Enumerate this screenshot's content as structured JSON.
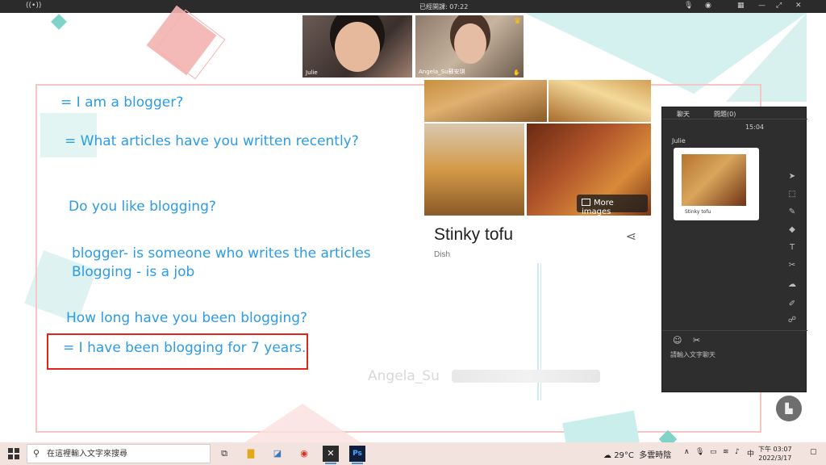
{
  "meeting": {
    "status_text": "已經開課: 07:22",
    "participant1_label": "Julie",
    "participant2_label": "Angela_Su蘇安琪"
  },
  "whiteboard": {
    "lines": [
      "= I am a blogger?",
      "= What articles have you written recently?",
      "Do you like blogging?",
      "blogger- is someone who writes the articles",
      "Blogging - is a job",
      "How long have you been blogging?",
      "= I have been blogging for 7 years."
    ],
    "watermark": "Angela_Su"
  },
  "image_card": {
    "more_images": "More images",
    "title": "Stinky tofu",
    "subtitle": "Dish"
  },
  "chat": {
    "tab_chat": "聊天",
    "tab_questions": "問題(0)",
    "time": "15:04",
    "sender": "Julie",
    "thumbnail_label": "Stinky tofu",
    "input_placeholder": "請輸入文字聊天"
  },
  "taskbar": {
    "search_placeholder": "在這裡輸入文字來搜尋",
    "temperature": "29°C",
    "weather_text": "多雲時陰",
    "ime": "中",
    "time": "下午 03:07",
    "date": "2022/3/17"
  },
  "colors": {
    "text_blue": "#2c9be8",
    "highlight_red": "#e1251b",
    "accent_teal": "#7fd3c8",
    "accent_pink": "#f3b3b0"
  }
}
